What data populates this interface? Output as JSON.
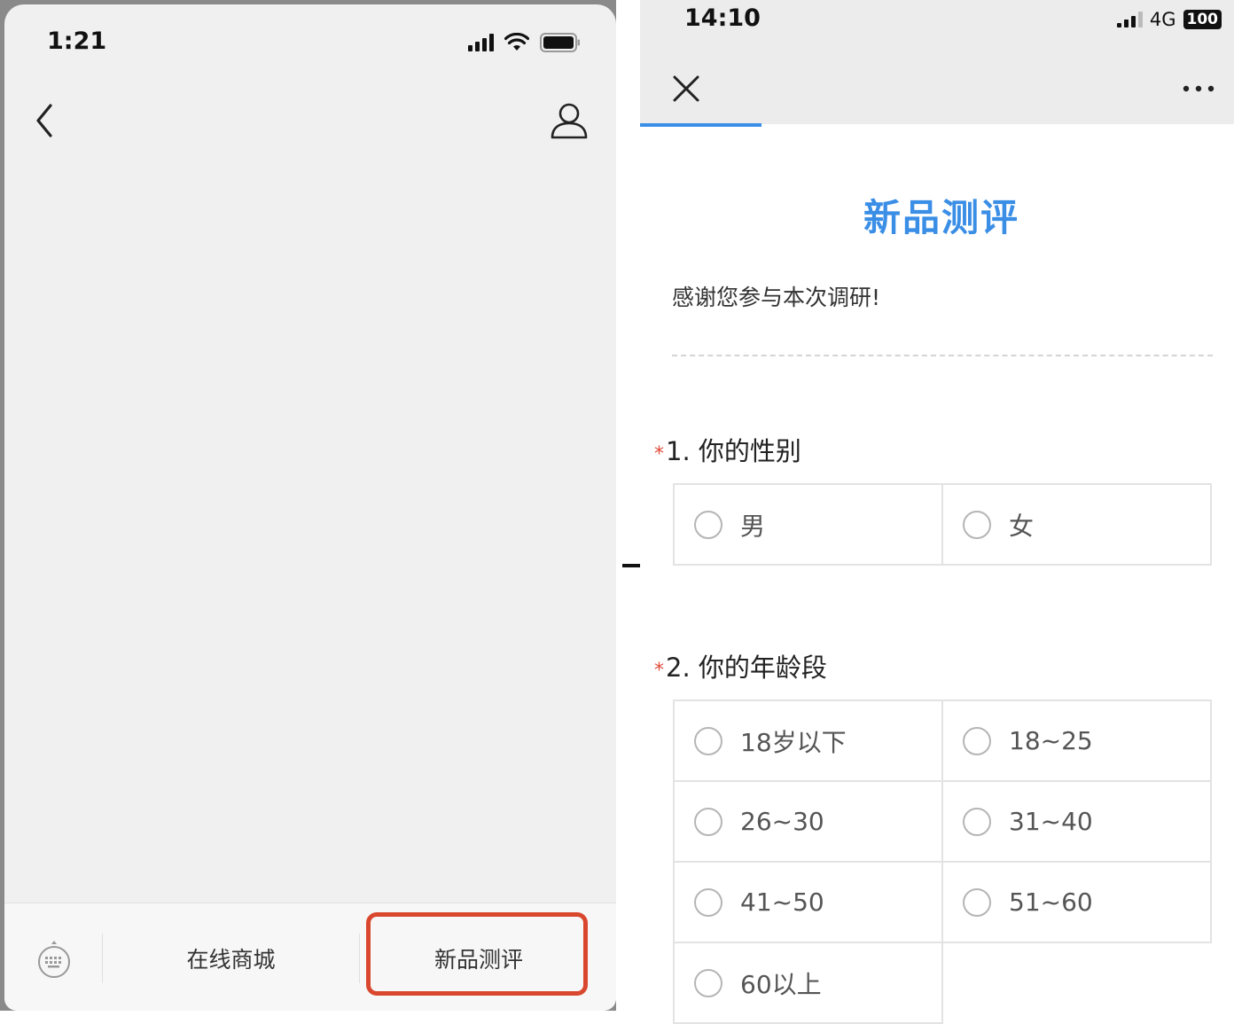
{
  "left_phone": {
    "status": {
      "time": "1:21"
    },
    "bottom_menu": {
      "items": [
        {
          "label": "在线商城"
        },
        {
          "label": "新品测评"
        }
      ],
      "highlight_color": "#d9482e"
    }
  },
  "right_phone": {
    "status": {
      "time": "14:10",
      "network": "4G",
      "battery": "100"
    },
    "accent_color": "#3a8ee6",
    "survey": {
      "title": "新品测评",
      "intro": "感谢您参与本次调研!",
      "questions": [
        {
          "required_mark": "*",
          "title": "1. 你的性别",
          "options": [
            "男",
            "女"
          ]
        },
        {
          "required_mark": "*",
          "title": "2. 你的年龄段",
          "options": [
            "18岁以下",
            "18~25",
            "26~30",
            "31~40",
            "41~50",
            "51~60",
            "60以上"
          ]
        }
      ]
    }
  },
  "icons": [
    "signal-icon",
    "wifi-icon",
    "battery-icon",
    "back-chevron-icon",
    "user-profile-icon",
    "keyboard-icon",
    "close-icon",
    "more-icon",
    "arrow-right-icon",
    "radio-icon"
  ]
}
